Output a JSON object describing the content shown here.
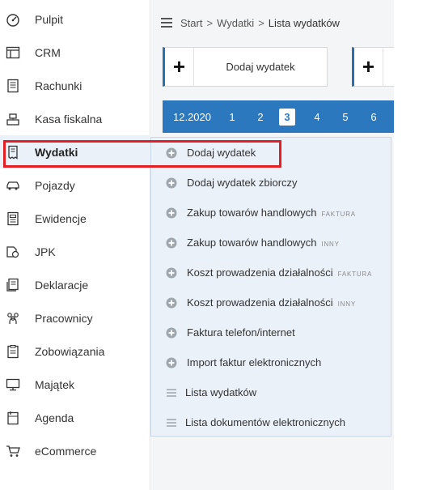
{
  "sidebar": {
    "items": [
      {
        "label": "Pulpit",
        "icon": "dashboard-icon"
      },
      {
        "label": "CRM",
        "icon": "window-icon"
      },
      {
        "label": "Rachunki",
        "icon": "receipt-icon"
      },
      {
        "label": "Kasa fiskalna",
        "icon": "cash-register-icon"
      },
      {
        "label": "Wydatki",
        "icon": "expense-icon",
        "active": true
      },
      {
        "label": "Pojazdy",
        "icon": "car-icon"
      },
      {
        "label": "Ewidencje",
        "icon": "register-icon"
      },
      {
        "label": "JPK",
        "icon": "jpk-icon"
      },
      {
        "label": "Deklaracje",
        "icon": "declaration-icon"
      },
      {
        "label": "Pracownicy",
        "icon": "employees-icon"
      },
      {
        "label": "Zobowiązania",
        "icon": "liabilities-icon"
      },
      {
        "label": "Majątek",
        "icon": "assets-icon"
      },
      {
        "label": "Agenda",
        "icon": "agenda-icon"
      },
      {
        "label": "eCommerce",
        "icon": "cart-icon"
      }
    ]
  },
  "breadcrumb": {
    "start": "Start",
    "section": "Wydatki",
    "current": "Lista wydatków",
    "separator": ">"
  },
  "quick_actions": {
    "add_expense_label": "Dodaj wydatek",
    "plus": "+"
  },
  "month_bar": {
    "current_label": "12.2020",
    "numbers": [
      "1",
      "2",
      "3",
      "4",
      "5",
      "6"
    ],
    "selected": "3"
  },
  "dropdown": {
    "items": [
      {
        "label": "Dodaj wydatek",
        "tag": "",
        "icon": "plus-circle-icon"
      },
      {
        "label": "Dodaj wydatek zbiorczy",
        "tag": "",
        "icon": "plus-circle-icon"
      },
      {
        "label": "Zakup towarów handlowych",
        "tag": "FAKTURA",
        "icon": "plus-circle-icon"
      },
      {
        "label": "Zakup towarów handlowych",
        "tag": "INNY",
        "icon": "plus-circle-icon"
      },
      {
        "label": "Koszt prowadzenia działalności",
        "tag": "FAKTURA",
        "icon": "plus-circle-icon"
      },
      {
        "label": "Koszt prowadzenia działalności",
        "tag": "INNY",
        "icon": "plus-circle-icon"
      },
      {
        "label": "Faktura telefon/internet",
        "tag": "",
        "icon": "plus-circle-icon"
      },
      {
        "label": "Import faktur elektronicznych",
        "tag": "",
        "icon": "plus-circle-icon"
      },
      {
        "label": "Lista wydatków",
        "tag": "",
        "icon": "list-icon"
      },
      {
        "label": "Lista dokumentów elektronicznych",
        "tag": "",
        "icon": "list-icon"
      }
    ]
  },
  "colors": {
    "accent": "#2c78bf",
    "highlight": "#e31e24",
    "dropdown_bg": "#eaf1f8"
  }
}
